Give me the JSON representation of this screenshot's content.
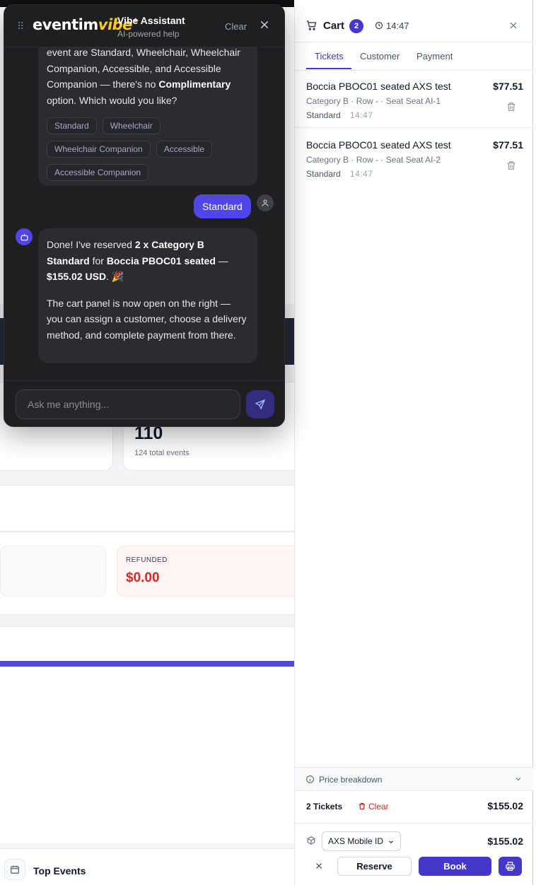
{
  "dashboard": {
    "stat_value": "110",
    "stat_sub": "124 total events",
    "refunded_label": "REFUNDED",
    "refunded_value": "$0.00",
    "bottom_title": "Top Events"
  },
  "assistant": {
    "logo_main": "eventim",
    "logo_accent": "vibe",
    "title": "Vibe Assistant",
    "subtitle": "AI-powered help",
    "clear_label": "Clear",
    "message1": {
      "text_part1": "event are Standard, Wheelchair, Wheelchair Companion, Accessible, and Accessible Companion — there's no ",
      "text_bold": "Complimentary",
      "text_part2": " option. Which would you like?",
      "chips": [
        "Standard",
        "Wheelchair",
        "Wheelchair Companion",
        "Accessible",
        "Accessible Companion"
      ]
    },
    "user_reply": "Standard",
    "message2": {
      "p1_a": "Done! I've reserved ",
      "p1_bold1": "2 x Category B Standard",
      "p1_b": " for ",
      "p1_bold2": "Boccia PBOC01 seated",
      "p1_c": " — ",
      "p1_bold3": "$155.02 USD",
      "p1_d": ". 🎉",
      "p2": "The cart panel is now open on the right — you can assign a customer, choose a delivery method, and complete payment from there."
    },
    "input_placeholder": "Ask me anything..."
  },
  "cart": {
    "title": "Cart",
    "count": "2",
    "timer": "14:47",
    "tabs": [
      "Tickets",
      "Customer",
      "Payment"
    ],
    "active_tab": "Tickets",
    "items": [
      {
        "name": "Boccia PBOC01 seated AXS test",
        "price": "$77.51",
        "details": "Category B · Row - · Seat Seat AI-1",
        "type": "Standard",
        "time": "14:47"
      },
      {
        "name": "Boccia PBOC01 seated AXS test",
        "price": "$77.51",
        "details": "Category B · Row - · Seat Seat AI-2",
        "type": "Standard",
        "time": "14:47"
      }
    ],
    "price_breakdown_label": "Price breakdown",
    "summary_count": "2 Tickets",
    "summary_clear": "Clear",
    "summary_total": "$155.02",
    "delivery_method": "AXS Mobile ID",
    "delivery_total": "$155.02",
    "reserve_label": "Reserve",
    "book_label": "Book"
  },
  "colors": {
    "accent": "#4338ca",
    "chat_bg": "#1f1f22",
    "danger": "#dc2626",
    "logo_accent": "#facc15"
  }
}
